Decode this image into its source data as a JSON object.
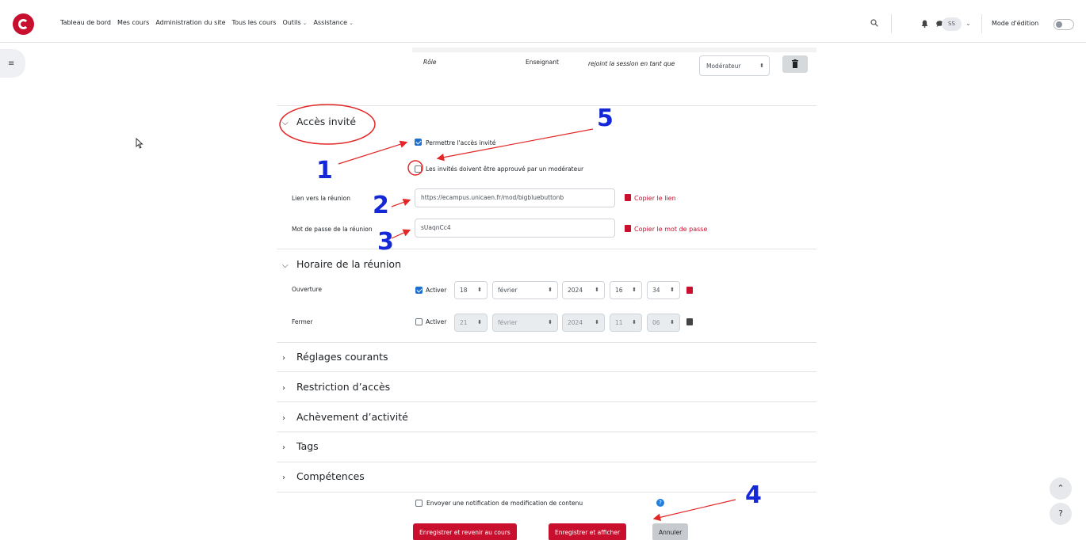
{
  "nav": {
    "items": [
      "Tableau de bord",
      "Mes cours",
      "Administration du site",
      "Tous les cours",
      "Outils",
      "Assistance"
    ],
    "avatar": "SS",
    "edit_mode": "Mode d'édition"
  },
  "role_row": {
    "header": "Rôle",
    "role": "Enseignant",
    "joins_as": "rejoint la session en tant que",
    "select": "Modérateur"
  },
  "guest": {
    "title": "Accès invité",
    "allow": "Permettre l'accès invité",
    "approve": "Les invités doivent être approuvé par un modérateur",
    "link_label": "Lien vers la réunion",
    "link_value": "https://ecampus.unicaen.fr/mod/bigbluebuttonb",
    "copy_link": "Copier le lien",
    "pwd_label": "Mot de passe de la réunion",
    "pwd_value": "sUaqnCc4",
    "copy_pwd": "Copier le mot de passe"
  },
  "schedule": {
    "title": "Horaire de la réunion",
    "open_label": "Ouverture",
    "close_label": "Fermer",
    "enable": "Activer",
    "open": {
      "day": "18",
      "month": "février",
      "year": "2024",
      "hour": "16",
      "minute": "34"
    },
    "close": {
      "day": "21",
      "month": "février",
      "year": "2024",
      "hour": "11",
      "minute": "06"
    }
  },
  "sections": [
    "Réglages courants",
    "Restriction d’accès",
    "Achèvement d’activité",
    "Tags",
    "Compétences"
  ],
  "notify": "Envoyer une notification de modification de contenu",
  "buttons": {
    "save_return": "Enregistrer et revenir au cours",
    "save_show": "Enregistrer et afficher",
    "cancel": "Annuler"
  },
  "help": "?",
  "annotations": [
    "1",
    "2",
    "3",
    "4",
    "5"
  ],
  "colors": {
    "brand": "#c8102e",
    "annotation_blue": "#1428d8",
    "annotation_red": "#e32626"
  }
}
